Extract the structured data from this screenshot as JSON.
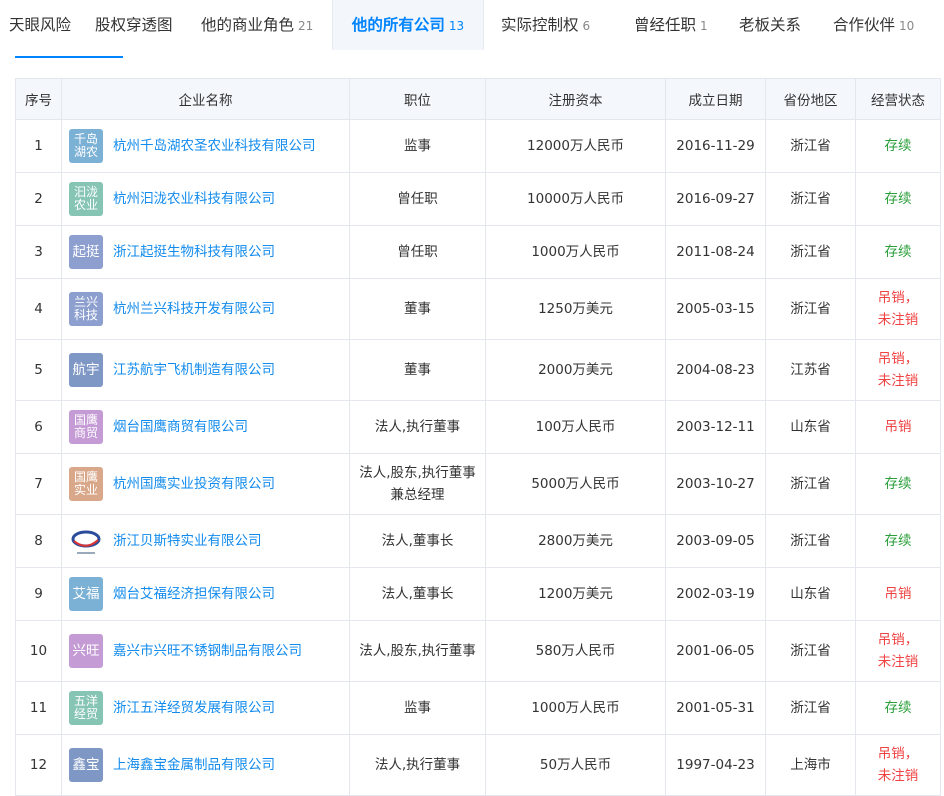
{
  "tabs": [
    {
      "label": "天眼风险",
      "count": ""
    },
    {
      "label": "股权穿透图",
      "count": ""
    },
    {
      "label": "他的商业角色",
      "count": "21"
    },
    {
      "label": "他的所有公司",
      "count": "13"
    },
    {
      "label": "实际控制权",
      "count": "6"
    },
    {
      "label": "曾经任职",
      "count": "1"
    },
    {
      "label": "老板关系",
      "count": ""
    },
    {
      "label": "合作伙伴",
      "count": "10"
    }
  ],
  "active_tab": "他的所有公司",
  "accent_color": "#0084ff",
  "table": {
    "headers": [
      "序号",
      "企业名称",
      "职位",
      "注册资本",
      "成立日期",
      "省份地区",
      "经营状态"
    ],
    "rows": [
      {
        "no": "1",
        "logo": "千岛湖农",
        "logo_color": "#7cb1d6",
        "name": "杭州千岛湖农圣农业科技有限公司",
        "position": "监事",
        "capital": "12000万人民币",
        "date": "2016-11-29",
        "region": "浙江省",
        "status": "存续",
        "status_type": "ok"
      },
      {
        "no": "2",
        "logo": "汩泷农业",
        "logo_color": "#86c5b3",
        "name": "杭州汩泷农业科技有限公司",
        "position": "曾任职",
        "capital": "10000万人民币",
        "date": "2016-09-27",
        "region": "浙江省",
        "status": "存续",
        "status_type": "ok"
      },
      {
        "no": "3",
        "logo": "起挺",
        "logo_color": "#8c9fcf",
        "name": "浙江起挺生物科技有限公司",
        "position": "曾任职",
        "capital": "1000万人民币",
        "date": "2011-08-24",
        "region": "浙江省",
        "status": "存续",
        "status_type": "ok"
      },
      {
        "no": "4",
        "logo": "兰兴科技",
        "logo_color": "#8c9fcf",
        "name": "杭州兰兴科技开发有限公司",
        "position": "董事",
        "capital": "1250万美元",
        "date": "2005-03-15",
        "region": "浙江省",
        "status": "吊销，未注销",
        "status_type": "bad"
      },
      {
        "no": "5",
        "logo": "航宇",
        "logo_color": "#7f97c4",
        "name": "江苏航宇飞机制造有限公司",
        "position": "董事",
        "capital": "2000万美元",
        "date": "2004-08-23",
        "region": "江苏省",
        "status": "吊销，未注销",
        "status_type": "bad"
      },
      {
        "no": "6",
        "logo": "国鹰商贸",
        "logo_color": "#c59bd6",
        "name": "烟台国鹰商贸有限公司",
        "position": "法人,执行董事",
        "capital": "100万人民币",
        "date": "2003-12-11",
        "region": "山东省",
        "status": "吊销",
        "status_type": "bad"
      },
      {
        "no": "7",
        "logo": "国鹰实业",
        "logo_color": "#d9a88a",
        "name": "杭州国鹰实业投资有限公司",
        "position": "法人,股东,执行董事兼总经理",
        "capital": "5000万人民币",
        "date": "2003-10-27",
        "region": "浙江省",
        "status": "存续",
        "status_type": "ok"
      },
      {
        "no": "8",
        "logo": "",
        "logo_color": "",
        "logo_image": true,
        "name": "浙江贝斯特实业有限公司",
        "position": "法人,董事长",
        "capital": "2800万美元",
        "date": "2003-09-05",
        "region": "浙江省",
        "status": "存续",
        "status_type": "ok"
      },
      {
        "no": "9",
        "logo": "艾福",
        "logo_color": "#7cb1d6",
        "name": "烟台艾福经济担保有限公司",
        "position": "法人,董事长",
        "capital": "1200万美元",
        "date": "2002-03-19",
        "region": "山东省",
        "status": "吊销",
        "status_type": "bad"
      },
      {
        "no": "10",
        "logo": "兴旺",
        "logo_color": "#c59bd6",
        "name": "嘉兴市兴旺不锈钢制品有限公司",
        "position": "法人,股东,执行董事",
        "capital": "580万人民币",
        "date": "2001-06-05",
        "region": "浙江省",
        "status": "吊销，未注销",
        "status_type": "bad"
      },
      {
        "no": "11",
        "logo": "五洋经贸",
        "logo_color": "#86c5b3",
        "name": "浙江五洋经贸发展有限公司",
        "position": "监事",
        "capital": "1000万人民币",
        "date": "2001-05-31",
        "region": "浙江省",
        "status": "存续",
        "status_type": "ok"
      },
      {
        "no": "12",
        "logo": "鑫宝",
        "logo_color": "#7f97c4",
        "name": "上海鑫宝金属制品有限公司",
        "position": "法人,执行董事",
        "capital": "50万人民币",
        "date": "1997-04-23",
        "region": "上海市",
        "status": "吊销，未注销",
        "status_type": "bad"
      }
    ]
  }
}
